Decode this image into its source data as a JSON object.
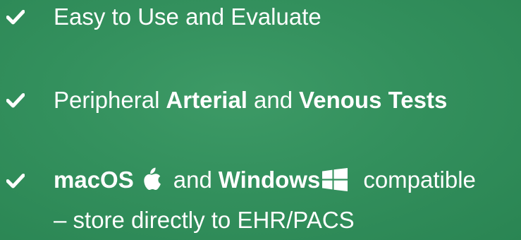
{
  "colors": {
    "background": "#33905d",
    "text": "#ffffff"
  },
  "features": [
    {
      "icon": "checkmark-icon",
      "parts": [
        "Easy to Use and Evaluate"
      ]
    },
    {
      "icon": "checkmark-icon",
      "parts": [
        "Peripheral",
        "Arterial",
        "and",
        "Venous Tests"
      ]
    },
    {
      "icon": "checkmark-icon",
      "parts": [
        "macOS",
        "and",
        "Windows",
        "compatible"
      ],
      "icons": [
        "apple-logo-icon",
        "windows-logo-icon"
      ],
      "subline": "– store directly to EHR/PACS"
    }
  ]
}
